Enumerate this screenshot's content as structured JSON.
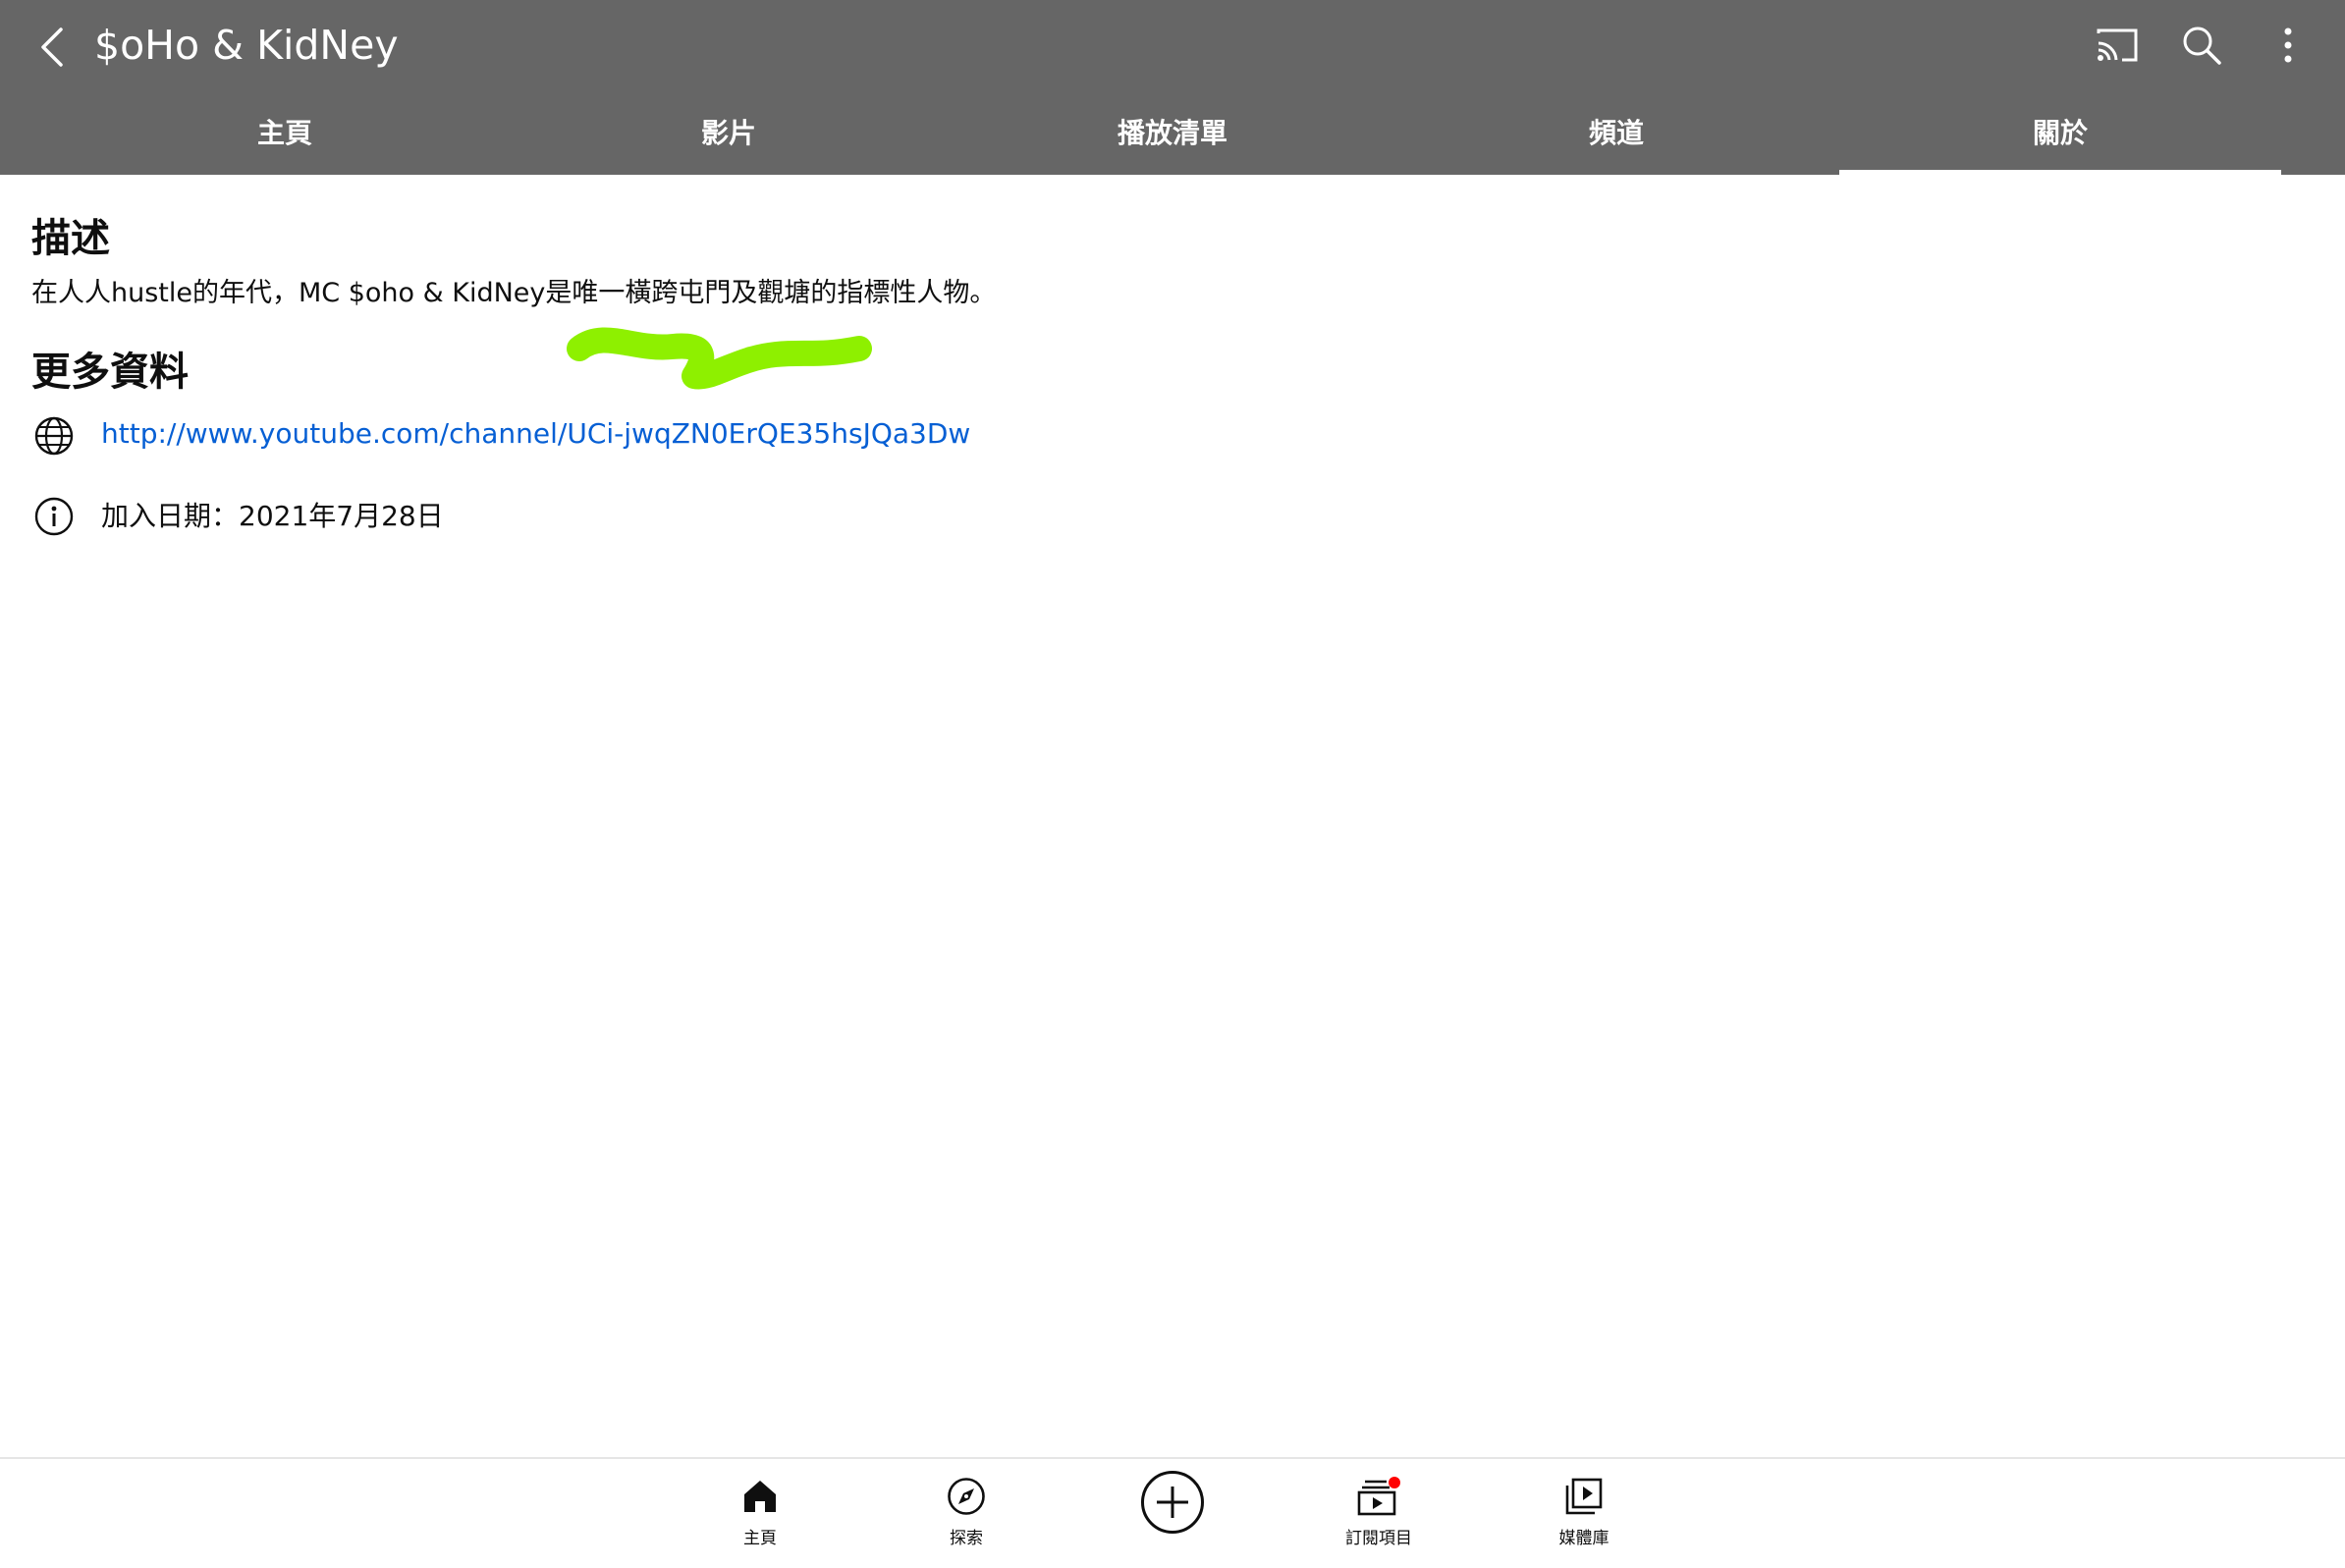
{
  "appbar": {
    "title": "$oHo & KidNey",
    "icons": [
      "back-arrow-icon",
      "cast-icon",
      "search-icon",
      "more-vert-icon"
    ]
  },
  "tabs": [
    {
      "label": "主頁"
    },
    {
      "label": "影片"
    },
    {
      "label": "播放清單"
    },
    {
      "label": "頻道"
    },
    {
      "label": "關於",
      "active": true
    }
  ],
  "about": {
    "description_heading": "描述",
    "description_text": "在人人hustle的年代，MC $oho & KidNey是唯一橫跨屯門及觀塘的指標性人物。",
    "more_info_heading": "更多資料",
    "link": "http://www.youtube.com/channel/UCi-jwqZN0ErQE35hsJQa3Dw",
    "joined": "加入日期：2021年7月28日"
  },
  "bottom_nav": [
    {
      "label": "主頁",
      "icon": "home-icon"
    },
    {
      "label": "探索",
      "icon": "explore-compass-icon"
    },
    {
      "label": "",
      "icon": "create-plus-icon"
    },
    {
      "label": "訂閱項目",
      "icon": "subscriptions-icon",
      "notification_dot": true
    },
    {
      "label": "媒體庫",
      "icon": "library-icon"
    }
  ],
  "colors": {
    "appbar_bg": "#666666",
    "link": "#065fd4",
    "scribble": "#8ef000",
    "notification_dot": "#ff0000"
  }
}
